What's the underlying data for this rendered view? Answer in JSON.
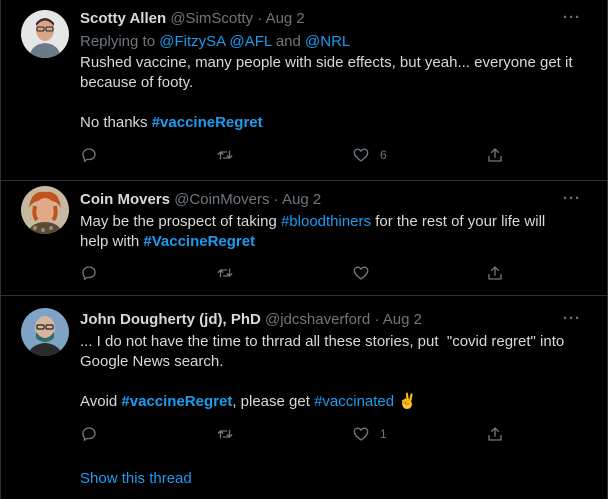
{
  "tweets": [
    {
      "name": "Scotty Allen",
      "handle": "@SimScotty",
      "date": "Aug 2",
      "more": "···",
      "reply_prefix": "Replying to ",
      "reply_user1": "@FitzySA",
      "reply_user2": "@AFL",
      "reply_and": " and ",
      "reply_user3": "@NRL",
      "line1": "Rushed vaccine, many people with side effects, but yeah... everyone get it",
      "line2": "because of footy.",
      "line3_text": "No thanks ",
      "line3_tag": "#vaccineRegret",
      "likes": "6"
    },
    {
      "name": "Coin Movers",
      "handle": "@CoinMovers",
      "date": "Aug 2",
      "more": "···",
      "line1_pre": "May be the prospect of taking ",
      "line1_tag": "#bloodthiners",
      "line1_post": " for the rest of your life will",
      "line2_pre": "help with ",
      "line2_tag": "#VaccineRegret"
    },
    {
      "name": "John Dougherty (jd), PhD",
      "handle": "@jdcshaverford",
      "date": "Aug 2",
      "more": "···",
      "line1": "... I do not have the time to thrrad all these stories, put  \"covid regret\" into",
      "line2": "Google News search.",
      "line3_pre": "Avoid ",
      "line3_tag1": "#vaccineRegret",
      "line3_mid": ", please get ",
      "line3_tag2": "#vaccinated",
      "line3_emoji": "✌",
      "likes": "1"
    }
  ],
  "show_thread": "Show this thread",
  "icons": [
    "reply-icon",
    "retweet-icon",
    "like-icon",
    "share-icon",
    "more-icon"
  ],
  "colors": {
    "link": "#1d9bf0",
    "muted": "#6e767d",
    "text": "#d9d9d9",
    "background": "#000000",
    "divider": "#2f3336"
  }
}
